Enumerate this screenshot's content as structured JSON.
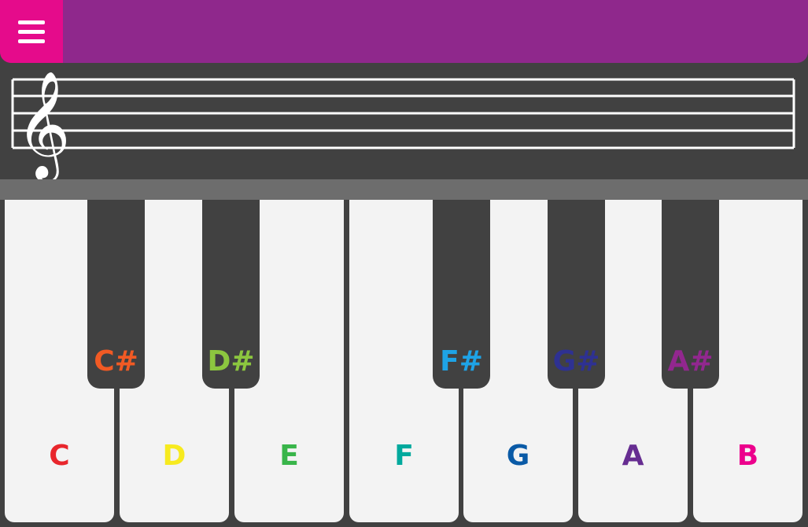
{
  "menu": {
    "icon": "hamburger-menu-icon"
  },
  "staff": {
    "clef": "𝄞",
    "clef_icon": "treble-clef-icon"
  },
  "white_keys": [
    {
      "note": "C",
      "color": "#e8262c"
    },
    {
      "note": "D",
      "color": "#f7ea1f"
    },
    {
      "note": "E",
      "color": "#39b54a"
    },
    {
      "note": "F",
      "color": "#00a99d"
    },
    {
      "note": "G",
      "color": "#0a5aa6"
    },
    {
      "note": "A",
      "color": "#662d91"
    },
    {
      "note": "B",
      "color": "#ec008c"
    }
  ],
  "black_keys": [
    {
      "note": "C#",
      "color": "#f15a24"
    },
    {
      "note": "D#",
      "color": "#8cc63f"
    },
    {
      "note": "F#",
      "color": "#1ea3e6"
    },
    {
      "note": "G#",
      "color": "#2e3192"
    },
    {
      "note": "A#",
      "color": "#92278f"
    }
  ]
}
